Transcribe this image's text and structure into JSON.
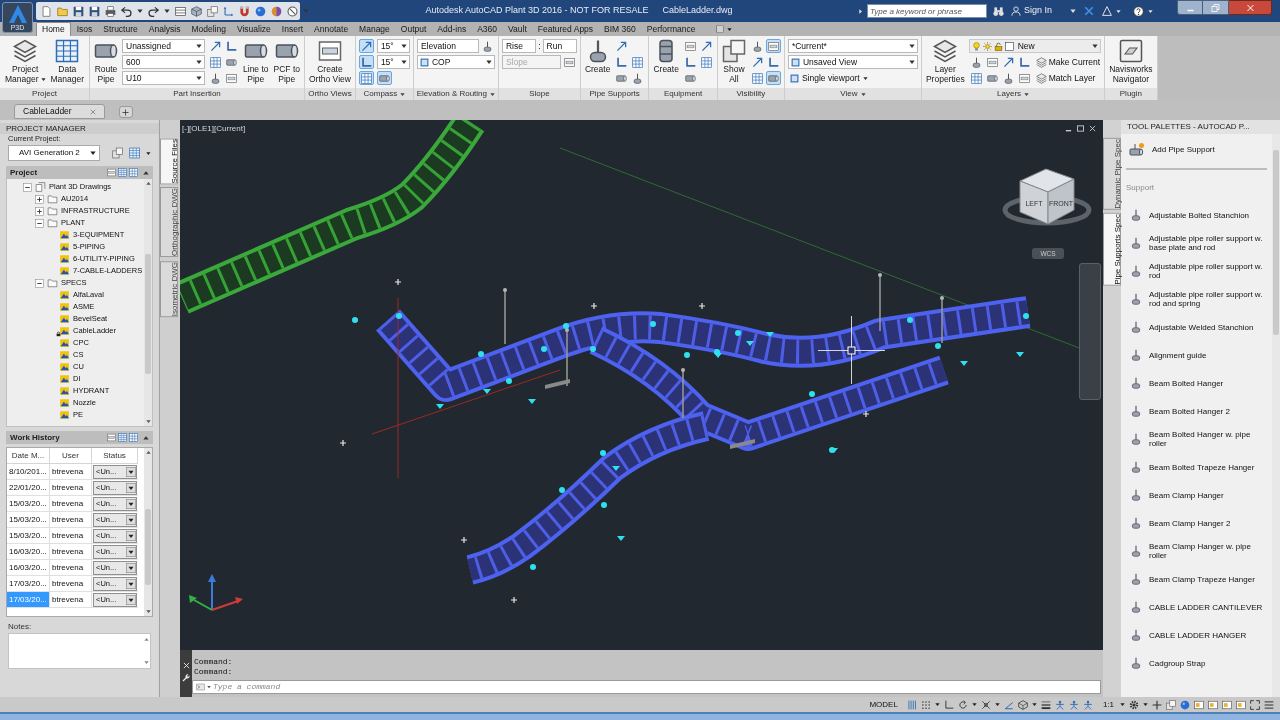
{
  "app_menu": {
    "label": "P3D"
  },
  "title_bar": {
    "title": "Autodesk AutoCAD Plant 3D 2016 - NOT FOR RESALE",
    "file": "CableLadder.dwg",
    "search": {
      "placeholder": "Type a keyword or phrase"
    },
    "sign_in": "Sign In"
  },
  "ribbon_tabs": [
    {
      "label": "Home",
      "selected": true
    },
    {
      "label": "Isos",
      "selected": false
    },
    {
      "label": "Structure",
      "selected": false
    },
    {
      "label": "Analysis",
      "selected": false
    },
    {
      "label": "Modeling",
      "selected": false
    },
    {
      "label": "Visualize",
      "selected": false
    },
    {
      "label": "Insert",
      "selected": false
    },
    {
      "label": "Annotate",
      "selected": false
    },
    {
      "label": "Manage",
      "selected": false
    },
    {
      "label": "Output",
      "selected": false
    },
    {
      "label": "Add-ins",
      "selected": false
    },
    {
      "label": "A360",
      "selected": false
    },
    {
      "label": "Vault",
      "selected": false
    },
    {
      "label": "Featured Apps",
      "selected": false
    },
    {
      "label": "BIM 360",
      "selected": false
    },
    {
      "label": "Performance",
      "selected": false
    }
  ],
  "ribbon_panels": [
    {
      "title": "Project",
      "menu": false,
      "columns": [
        {
          "kind": "large",
          "lines": [
            "Project",
            "Manager"
          ],
          "menu": true
        },
        {
          "kind": "large",
          "lines": [
            "Data",
            "Manager"
          ],
          "menu": false
        }
      ]
    },
    {
      "title": "Part Insertion",
      "menu": false,
      "columns": [
        {
          "kind": "large",
          "lines": [
            "Route",
            "Pipe"
          ],
          "menu": false
        },
        {
          "kind": "stack",
          "rows": [
            [
              {
                "kind": "dropdown",
                "value": "Unassigned"
              }
            ],
            [
              {
                "kind": "dropdown",
                "value": "600"
              }
            ],
            [
              {
                "kind": "dropdown",
                "value": "U10"
              }
            ]
          ]
        },
        {
          "kind": "stack",
          "rows": [
            [
              {
                "kind": "tool",
                "on": false
              },
              {
                "kind": "tool",
                "on": false
              }
            ],
            [
              {
                "kind": "tool",
                "on": false
              },
              {
                "kind": "tool",
                "on": false
              }
            ],
            [
              {
                "kind": "tool",
                "on": false
              },
              {
                "kind": "tool",
                "on": false
              }
            ]
          ]
        },
        {
          "kind": "large",
          "lines": [
            "Line to",
            "Pipe"
          ],
          "menu": false
        },
        {
          "kind": "large",
          "lines": [
            "PCF to",
            "Pipe"
          ],
          "menu": false
        }
      ]
    },
    {
      "title": "Ortho Views",
      "menu": false,
      "columns": [
        {
          "kind": "large",
          "lines": [
            "Create",
            "Ortho View"
          ],
          "menu": false
        }
      ]
    },
    {
      "title": "Compass",
      "menu": true,
      "columns": [
        {
          "kind": "stack",
          "rows": [
            [
              {
                "kind": "tool",
                "on": true
              }
            ],
            [
              {
                "kind": "tool",
                "on": true
              }
            ],
            [
              {
                "kind": "tool",
                "on": true
              }
            ]
          ]
        },
        {
          "kind": "stack",
          "rows": [
            [
              {
                "kind": "dropdown",
                "value": "15°"
              }
            ],
            [
              {
                "kind": "dropdown",
                "value": "15°"
              }
            ],
            [
              {
                "kind": "tool",
                "on": true
              }
            ]
          ]
        }
      ]
    },
    {
      "title": "Elevation & Routing",
      "menu": true,
      "columns": [
        {
          "kind": "stack",
          "rows": [
            [
              {
                "kind": "field",
                "value": "Elevation",
                "disabled": false
              },
              {
                "kind": "tool",
                "on": false
              }
            ],
            [
              {
                "kind": "icon-dropdown",
                "value": "COP"
              }
            ]
          ]
        }
      ]
    },
    {
      "title": "Slope",
      "menu": false,
      "columns": [
        {
          "kind": "stack",
          "rows": [
            [
              {
                "kind": "field",
                "value": "Rise",
                "disabled": false
              },
              {
                "kind": "label",
                "text": ":"
              },
              {
                "kind": "field",
                "value": "Run",
                "disabled": false
              }
            ],
            [
              {
                "kind": "field",
                "placeholder": "Slope",
                "disabled": true
              },
              {
                "kind": "tool",
                "on": false
              }
            ]
          ]
        }
      ]
    },
    {
      "title": "Pipe Supports",
      "menu": false,
      "columns": [
        {
          "kind": "large",
          "lines": [
            "Create"
          ],
          "menu": false
        },
        {
          "kind": "stack",
          "rows": [
            [
              {
                "kind": "tool",
                "on": false
              }
            ],
            [
              {
                "kind": "tool",
                "on": false
              },
              {
                "kind": "tool",
                "on": false
              }
            ],
            [
              {
                "kind": "tool",
                "on": false
              },
              {
                "kind": "tool",
                "on": false
              }
            ]
          ]
        }
      ]
    },
    {
      "title": "Equipment",
      "menu": false,
      "columns": [
        {
          "kind": "large",
          "lines": [
            "Create"
          ],
          "menu": false
        },
        {
          "kind": "stack",
          "rows": [
            [
              {
                "kind": "tool",
                "on": false
              },
              {
                "kind": "tool",
                "on": false
              }
            ],
            [
              {
                "kind": "tool",
                "on": false
              },
              {
                "kind": "tool",
                "on": false
              }
            ],
            [
              {
                "kind": "tool",
                "on": false
              }
            ]
          ]
        }
      ]
    },
    {
      "title": "Visibility",
      "menu": false,
      "columns": [
        {
          "kind": "large",
          "lines": [
            "Show",
            "All"
          ],
          "menu": false
        },
        {
          "kind": "stack",
          "rows": [
            [
              {
                "kind": "tool",
                "on": false
              },
              {
                "kind": "tool",
                "on": true
              }
            ],
            [
              {
                "kind": "tool",
                "on": false
              },
              {
                "kind": "tool",
                "on": false
              }
            ],
            [
              {
                "kind": "tool",
                "on": false
              },
              {
                "kind": "tool",
                "on": true
              }
            ]
          ]
        }
      ]
    },
    {
      "title": "View",
      "menu": true,
      "columns": [
        {
          "kind": "stack",
          "rows": [
            [
              {
                "kind": "dropdown",
                "value": "*Current*"
              }
            ],
            [
              {
                "kind": "icon-dropdown",
                "value": "Unsaved View"
              }
            ],
            [
              {
                "kind": "menu-button",
                "label": "Single viewport"
              }
            ]
          ]
        }
      ]
    },
    {
      "title": "Layers",
      "menu": true,
      "columns": [
        {
          "kind": "large",
          "lines": [
            "Layer",
            "Properties"
          ],
          "menu": false
        },
        {
          "kind": "stack",
          "rows": [
            [
              {
                "kind": "layer-dropdown",
                "value": "New"
              }
            ],
            [
              {
                "kind": "tool",
                "on": false
              },
              {
                "kind": "tool",
                "on": false
              },
              {
                "kind": "tool",
                "on": false
              },
              {
                "kind": "tool",
                "on": false
              },
              {
                "kind": "text-button",
                "label": "Make Current"
              }
            ],
            [
              {
                "kind": "tool",
                "on": false
              },
              {
                "kind": "tool",
                "on": false
              },
              {
                "kind": "tool",
                "on": false
              },
              {
                "kind": "tool",
                "on": false
              },
              {
                "kind": "text-button",
                "label": "Match Layer"
              }
            ]
          ]
        }
      ]
    },
    {
      "title": "Plugin",
      "menu": false,
      "columns": [
        {
          "kind": "large",
          "lines": [
            "Navisworks",
            "Navigator"
          ],
          "menu": false
        }
      ]
    }
  ],
  "document_tabs": [
    {
      "label": "CableLadder",
      "selected": true
    }
  ],
  "project_manager": {
    "title": "PROJECT MANAGER",
    "current_project_label": "Current Project:",
    "current_project": "AVI Generation 2",
    "tree_title": "Project",
    "tree": [
      {
        "label": "Plant 3D Drawings",
        "expanded": true,
        "children": [
          {
            "label": "AU2014",
            "expanded": false
          },
          {
            "label": "INFRASTRUCTURE",
            "expanded": false
          },
          {
            "label": "PLANT",
            "expanded": true,
            "children": [
              {
                "label": "3-EQUIPMENT",
                "locked": false
              },
              {
                "label": "5-PIPING",
                "locked": false
              },
              {
                "label": "6-UTILITY-PIPING",
                "locked": false
              },
              {
                "label": "7-CABLE-LADDERS",
                "locked": false
              }
            ]
          },
          {
            "label": "SPECS",
            "expanded": true,
            "children": [
              {
                "label": "AlfaLaval",
                "locked": false
              },
              {
                "label": "ASME",
                "locked": false
              },
              {
                "label": "BevelSeat",
                "locked": false
              },
              {
                "label": "CableLadder",
                "locked": true
              },
              {
                "label": "CPC",
                "locked": false
              },
              {
                "label": "CS",
                "locked": false
              },
              {
                "label": "CU",
                "locked": false
              },
              {
                "label": "DI",
                "locked": false
              },
              {
                "label": "HYDRANT",
                "locked": false
              },
              {
                "label": "Nozzle",
                "locked": false
              },
              {
                "label": "PE",
                "locked": false
              }
            ]
          }
        ]
      }
    ],
    "work_history": {
      "title": "Work History",
      "columns": [
        "Date M...",
        "User",
        "Status"
      ],
      "rows": [
        {
          "date": "8/10/201...",
          "user": "btrevena",
          "status": "<Un...",
          "selected": false
        },
        {
          "date": "22/01/20...",
          "user": "btrevena",
          "status": "<Un...",
          "selected": false
        },
        {
          "date": "15/03/20...",
          "user": "btrevena",
          "status": "<Un...",
          "selected": false
        },
        {
          "date": "15/03/20...",
          "user": "btrevena",
          "status": "<Un...",
          "selected": false
        },
        {
          "date": "15/03/20...",
          "user": "btrevena",
          "status": "<Un...",
          "selected": false
        },
        {
          "date": "16/03/20...",
          "user": "btrevena",
          "status": "<Un...",
          "selected": false
        },
        {
          "date": "16/03/20...",
          "user": "btrevena",
          "status": "<Un...",
          "selected": false
        },
        {
          "date": "17/03/20...",
          "user": "btrevena",
          "status": "<Un...",
          "selected": false
        },
        {
          "date": "17/03/20...",
          "user": "btrevena",
          "status": "<Un...",
          "selected": true
        }
      ]
    },
    "notes_label": "Notes:",
    "side_tabs": [
      {
        "label": "Source Files",
        "selected": true
      },
      {
        "label": "Orthographic DWG",
        "selected": false
      },
      {
        "label": "Isometric DWG",
        "selected": false
      }
    ]
  },
  "viewport": {
    "label": "[-][OLE1][Current]",
    "viewcube": {
      "left": "LEFT",
      "front": "FRONT"
    },
    "ucs_menu": "WCS"
  },
  "command_line": {
    "history": [
      "Command:",
      "Command:"
    ],
    "placeholder": "Type a command"
  },
  "tool_palette": {
    "title": "TOOL PALETTES - AUTOCAD P...",
    "add_button": "Add Pipe Support",
    "section": "Support",
    "items": [
      {
        "label": "Adjustable Bolted Stanchion"
      },
      {
        "label": "Adjustable pipe roller support w. base plate and rod"
      },
      {
        "label": "Adjustable pipe roller support w. rod"
      },
      {
        "label": "Adjustable pipe roller support w. rod and spring"
      },
      {
        "label": "Adjustable Welded Stanchion"
      },
      {
        "label": "Alignment guide"
      },
      {
        "label": "Beam Bolted Hanger"
      },
      {
        "label": "Beam Bolted Hanger 2"
      },
      {
        "label": "Beam Bolted Hanger w. pipe roller"
      },
      {
        "label": "Beam Bolted Trapeze Hanger"
      },
      {
        "label": "Beam Clamp Hanger"
      },
      {
        "label": "Beam Clamp Hanger 2"
      },
      {
        "label": "Beam Clamp Hanger w. pipe roller"
      },
      {
        "label": "Beam Clamp Trapeze Hanger"
      },
      {
        "label": "CABLE LADDER CANTILEVER"
      },
      {
        "label": "CABLE LADDER HANGER"
      },
      {
        "label": "Cadgroup Strap"
      }
    ],
    "side_tabs": [
      {
        "label": "Dynamic Pipe Spec",
        "selected": false
      },
      {
        "label": "Pipe Supports Spec",
        "selected": true
      }
    ]
  },
  "status_bar": {
    "space": "MODEL",
    "scale": "1:1"
  }
}
